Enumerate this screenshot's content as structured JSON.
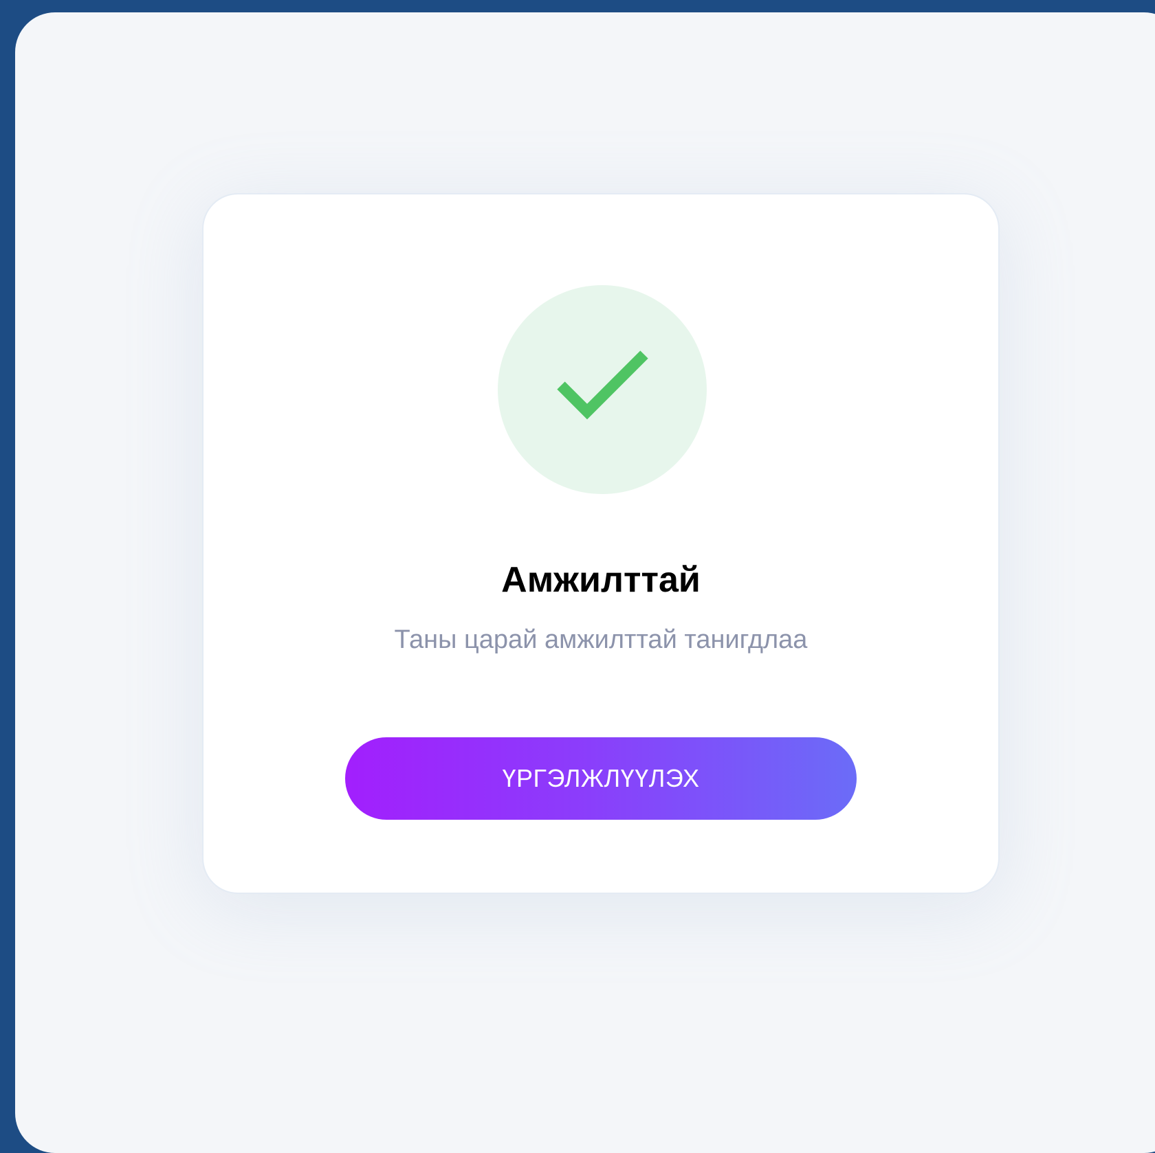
{
  "dialog": {
    "title": "Амжилттай",
    "message": "Таны царай амжилттай танигдлаа",
    "continue_label": "ҮРГЭЛЖЛҮҮЛЭХ"
  },
  "icons": {
    "status": "check-icon"
  },
  "colors": {
    "check": "#4fc463",
    "check_bg": "#e7f6ec",
    "button_gradient_start": "#a21ffd",
    "button_gradient_end": "#6b6cf8",
    "message": "#8c93ab"
  }
}
